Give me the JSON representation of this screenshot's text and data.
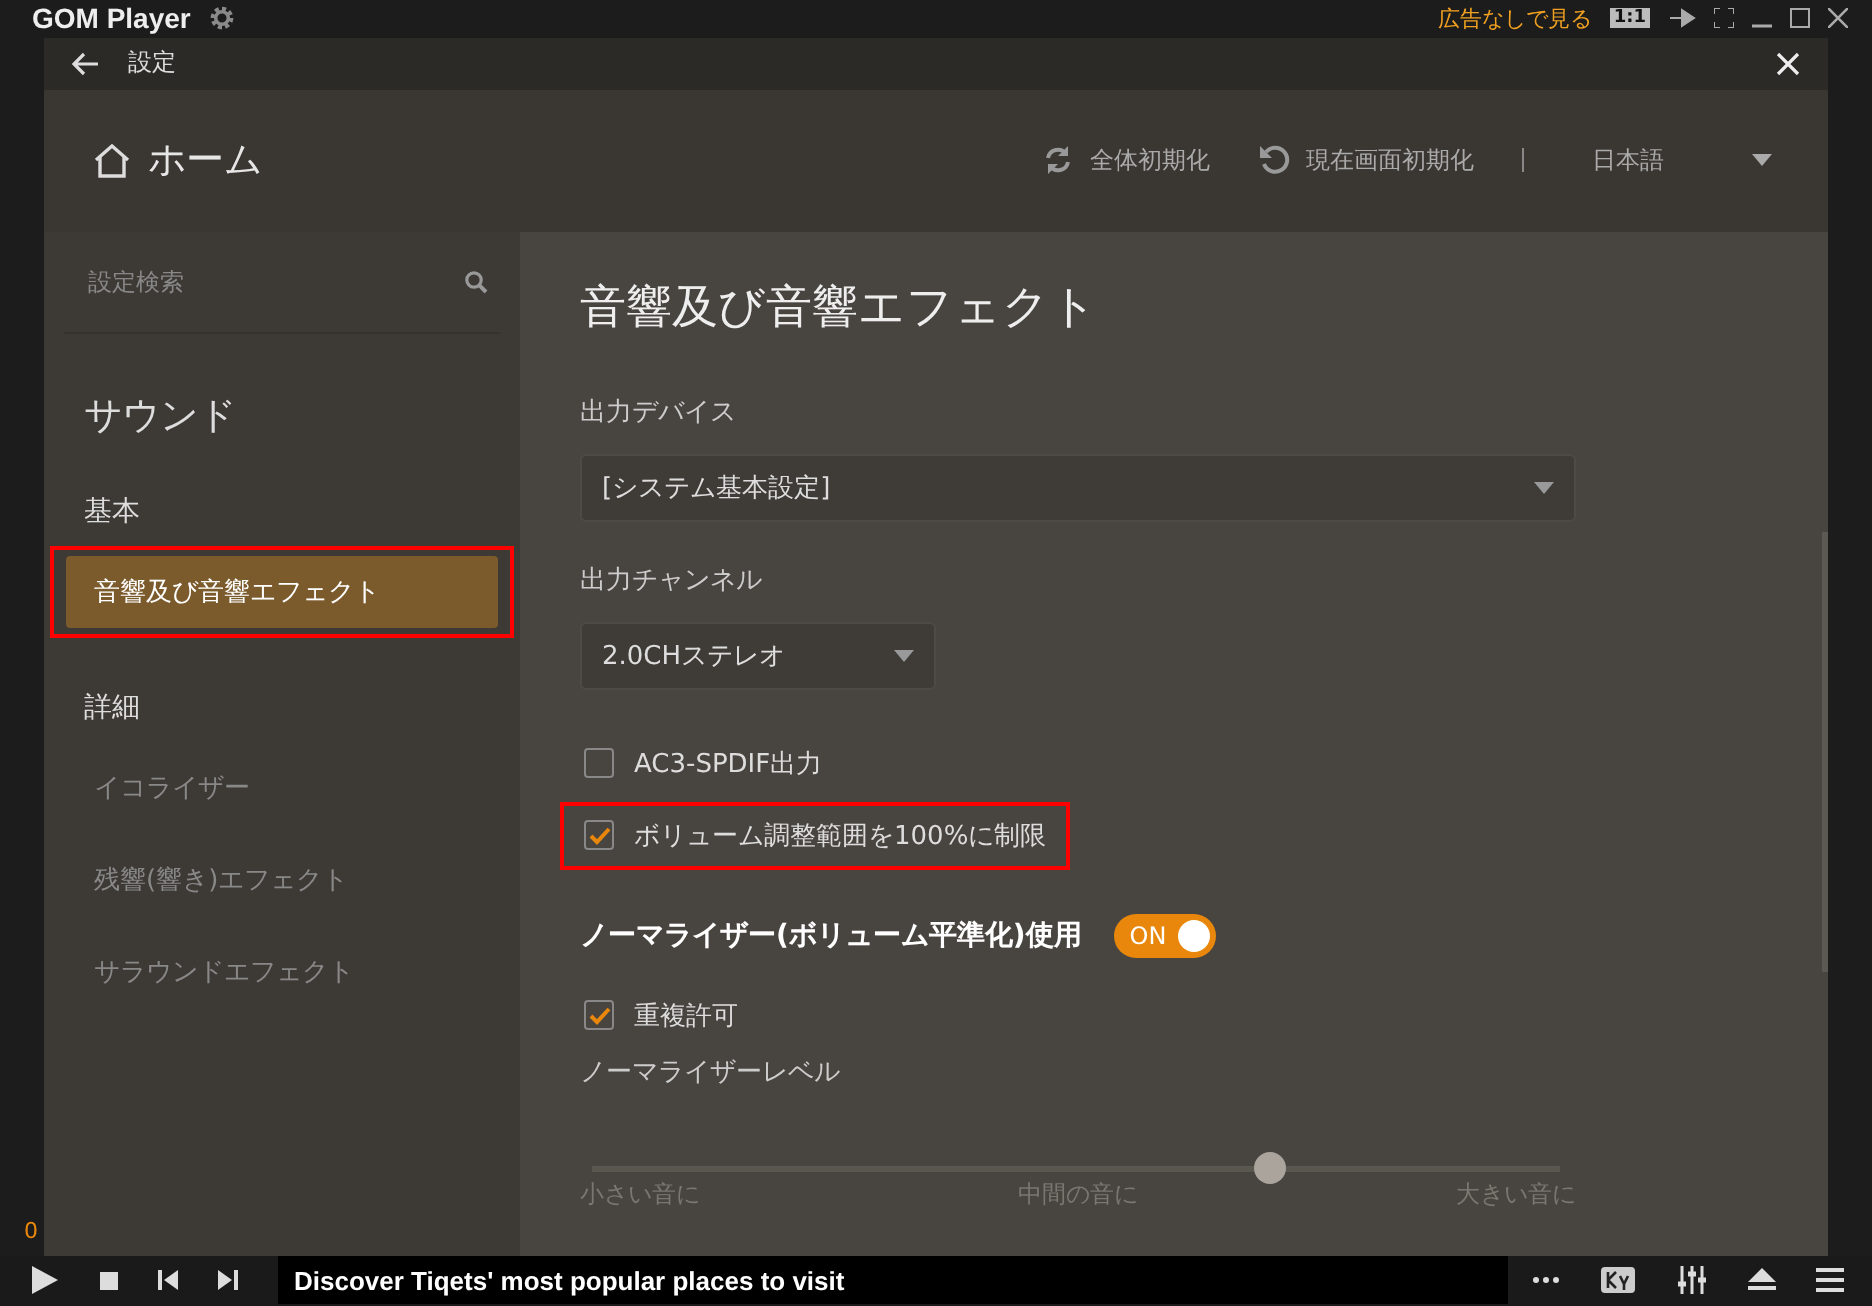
{
  "app": {
    "title": "GOM Player",
    "ad_link": "広告なしで見る",
    "ratio_button": "1:1",
    "time": "0"
  },
  "dialog": {
    "title": "設定"
  },
  "header": {
    "home": "ホーム",
    "actions": [
      {
        "kind": "reset-all",
        "label": "全体初期化"
      },
      {
        "kind": "reset-page",
        "label": "現在画面初期化"
      }
    ],
    "language": "日本語"
  },
  "sidebar": {
    "search": {
      "placeholder": "設定検索"
    },
    "section": "サウンド",
    "groups": [
      {
        "label": "基本",
        "items": [
          {
            "label": "音響及び音響エフェクト",
            "selected": true,
            "highlighted": true
          }
        ]
      },
      {
        "label": "詳細",
        "items": [
          {
            "label": "イコライザー",
            "selected": false,
            "highlighted": false
          },
          {
            "label": "残響(響き)エフェクト",
            "selected": false,
            "highlighted": false
          },
          {
            "label": "サラウンドエフェクト",
            "selected": false,
            "highlighted": false
          }
        ]
      }
    ]
  },
  "content": {
    "title": "音響及び音響エフェクト",
    "items": [
      {
        "kind": "label",
        "text": "出力デバイス"
      },
      {
        "kind": "dropdown",
        "value": "[システム基本設定]",
        "wide": true
      },
      {
        "kind": "label",
        "text": "出力チャンネル"
      },
      {
        "kind": "dropdown",
        "value": "2.0CHステレオ",
        "wide": false
      },
      {
        "kind": "checkbox",
        "text": "AC3-SPDIF出力",
        "checked": false,
        "highlighted": false
      },
      {
        "kind": "checkbox",
        "text": "ボリューム調整範囲を100%に制限",
        "checked": true,
        "highlighted": true
      },
      {
        "kind": "toggle",
        "text": "ノーマライザー(ボリューム平準化)使用",
        "on": true,
        "state_label": "ON"
      },
      {
        "kind": "checkbox",
        "text": "重複許可",
        "checked": true,
        "highlighted": false
      },
      {
        "kind": "label",
        "text": "ノーマライザーレベル"
      },
      {
        "kind": "slider",
        "level": 0.7,
        "ticks": [
          "小さい音に",
          "中間の音に",
          "大きい音に"
        ]
      }
    ]
  },
  "player": {
    "now_playing": "Discover Tiqets' most popular places to visit"
  }
}
